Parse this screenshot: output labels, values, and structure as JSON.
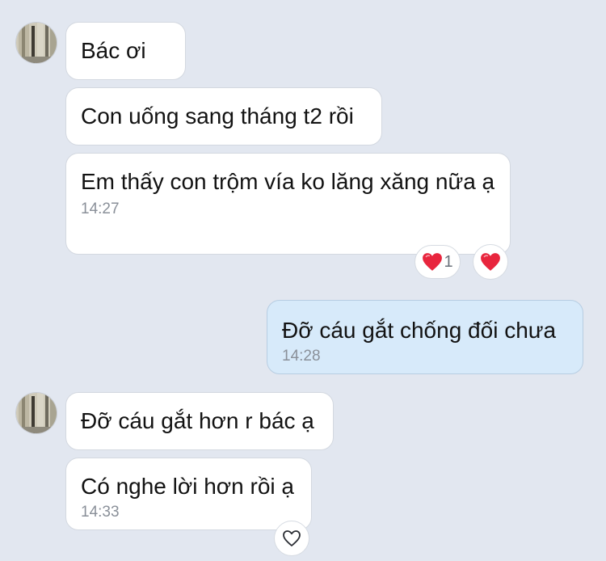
{
  "conversation": {
    "messages": [
      {
        "text": "Bác ơi"
      },
      {
        "text": "Con uống sang tháng t2 rồi"
      },
      {
        "text": "Em thấy con trộm vía ko lăng xăng nữa ạ",
        "time": "14:27"
      },
      {
        "text": "Đỡ cáu gắt chống đối chưa",
        "time": "14:28"
      },
      {
        "text": "Đỡ cáu gắt hơn r bác ạ"
      },
      {
        "text": "Có nghe lời hơn rồi ạ",
        "time": "14:33"
      }
    ],
    "reactions": {
      "heart_count": "1"
    }
  },
  "icons": {
    "reaction_summary": "heart-icon",
    "quick_reaction": "heart-icon",
    "react_button": "heart-outline-icon"
  },
  "colors": {
    "background": "#e2e7f0",
    "incoming_bubble": "#ffffff",
    "outgoing_bubble": "#d7eafa",
    "heart": "#e8253d",
    "timestamp": "#8a9099"
  }
}
